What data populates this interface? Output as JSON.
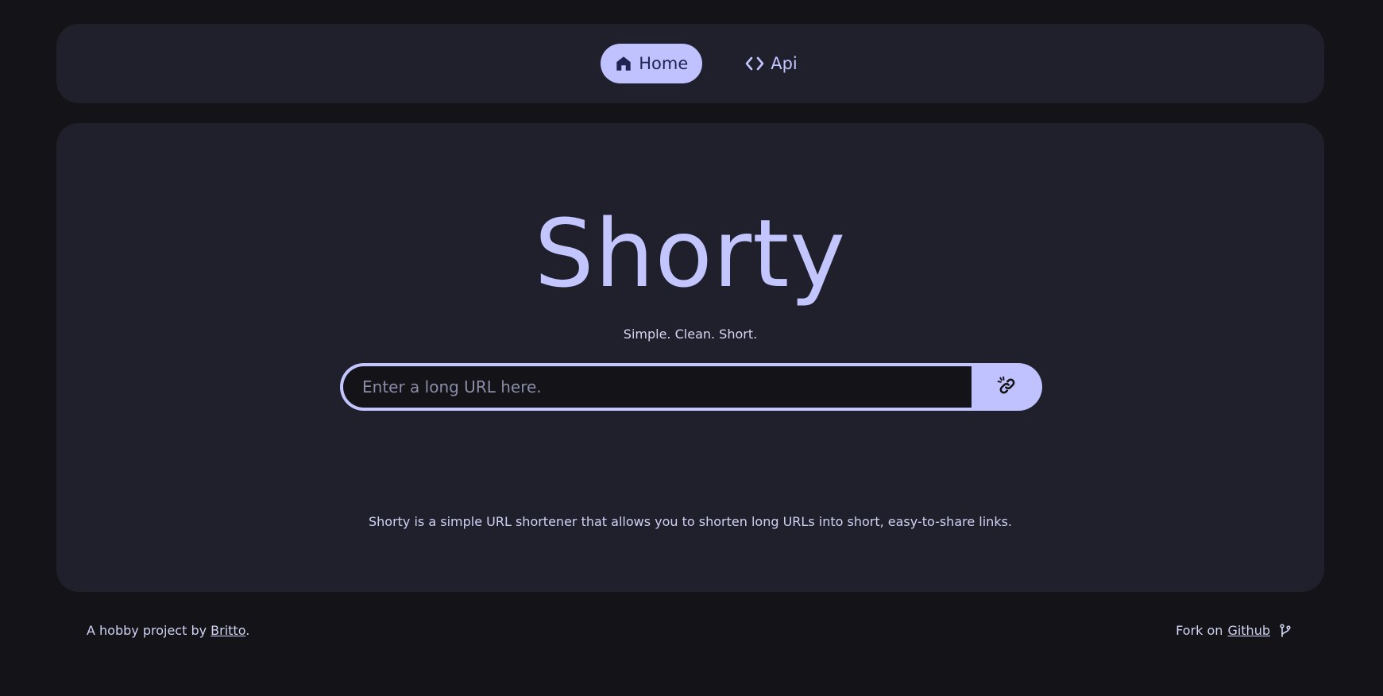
{
  "nav": {
    "items": [
      {
        "label": "Home",
        "icon": "home-icon",
        "active": true
      },
      {
        "label": "Api",
        "icon": "code-icon",
        "active": false
      }
    ]
  },
  "hero": {
    "title": "Shorty",
    "tagline": "Simple. Clean. Short."
  },
  "form": {
    "placeholder": "Enter a long URL here.",
    "value": "",
    "button_icon": "link-icon"
  },
  "description": "Shorty is a simple URL shortener that allows you to shorten long URLs into short, easy-to-share links.",
  "footer": {
    "left_prefix": "A hobby project by ",
    "author": "Britto",
    "left_suffix": ".",
    "right_prefix": "Fork on ",
    "repo_label": "Github",
    "repo_icon": "git-branch-icon"
  },
  "colors": {
    "background": "#131318",
    "surface": "#20202c",
    "accent": "#bfc2ff",
    "text": "#c3c5ff"
  }
}
